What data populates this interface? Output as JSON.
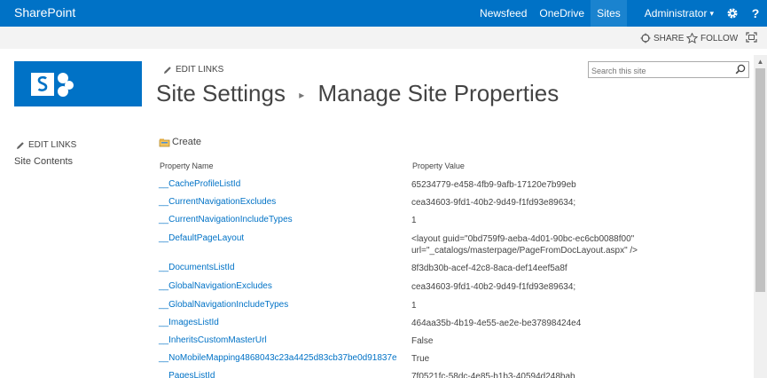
{
  "suitebar": {
    "brand": "SharePoint",
    "links": [
      "Newsfeed",
      "OneDrive",
      "Sites"
    ],
    "active_link": "Sites",
    "user": "Administrator",
    "user_caret": "▾",
    "settings_icon": "gear-icon",
    "help_label": "?"
  },
  "ribbon": {
    "share_label": "SHARE",
    "follow_label": "FOLLOW"
  },
  "edit_links_label": "EDIT LINKS",
  "leftnav": {
    "edit_links_label": "EDIT LINKS",
    "site_contents_label": "Site Contents"
  },
  "title": {
    "parent": "Site Settings",
    "separator": "▸",
    "current": "Manage Site Properties"
  },
  "search": {
    "placeholder": "Search this site"
  },
  "create_label": "Create",
  "table": {
    "headers": [
      "Property Name",
      "Property Value"
    ],
    "rows": [
      {
        "name": "__CacheProfileListId",
        "value": "65234779-e458-4fb9-9afb-17120e7b99eb"
      },
      {
        "name": "__CurrentNavigationExcludes",
        "value": "cea34603-9fd1-40b2-9d49-f1fd93e89634;"
      },
      {
        "name": "__CurrentNavigationIncludeTypes",
        "value": "1"
      },
      {
        "name": "__DefaultPageLayout",
        "value": "<layout guid=\"0bd759f9-aeba-4d01-90bc-ec6cb0088f00\"",
        "value2": "url=\"_catalogs/masterpage/PageFromDocLayout.aspx\" />"
      },
      {
        "name": "__DocumentsListId",
        "value": "8f3db30b-acef-42c8-8aca-def14eef5a8f"
      },
      {
        "name": "__GlobalNavigationExcludes",
        "value": "cea34603-9fd1-40b2-9d49-f1fd93e89634;"
      },
      {
        "name": "__GlobalNavigationIncludeTypes",
        "value": "1"
      },
      {
        "name": "__ImagesListId",
        "value": "464aa35b-4b19-4e55-ae2e-be37898424e4"
      },
      {
        "name": "__InheritsCustomMasterUrl",
        "value": "False"
      },
      {
        "name": "__NoMobileMapping4868043c23a4425d83cb37be0d91837e",
        "value": "True"
      },
      {
        "name": "__PagesListId",
        "value": "7f0521fc-58dc-4e85-b1b3-40594d248bab"
      }
    ]
  },
  "colors": {
    "suitebar": "#0072c6",
    "link": "#0072c6",
    "text": "#444444"
  }
}
